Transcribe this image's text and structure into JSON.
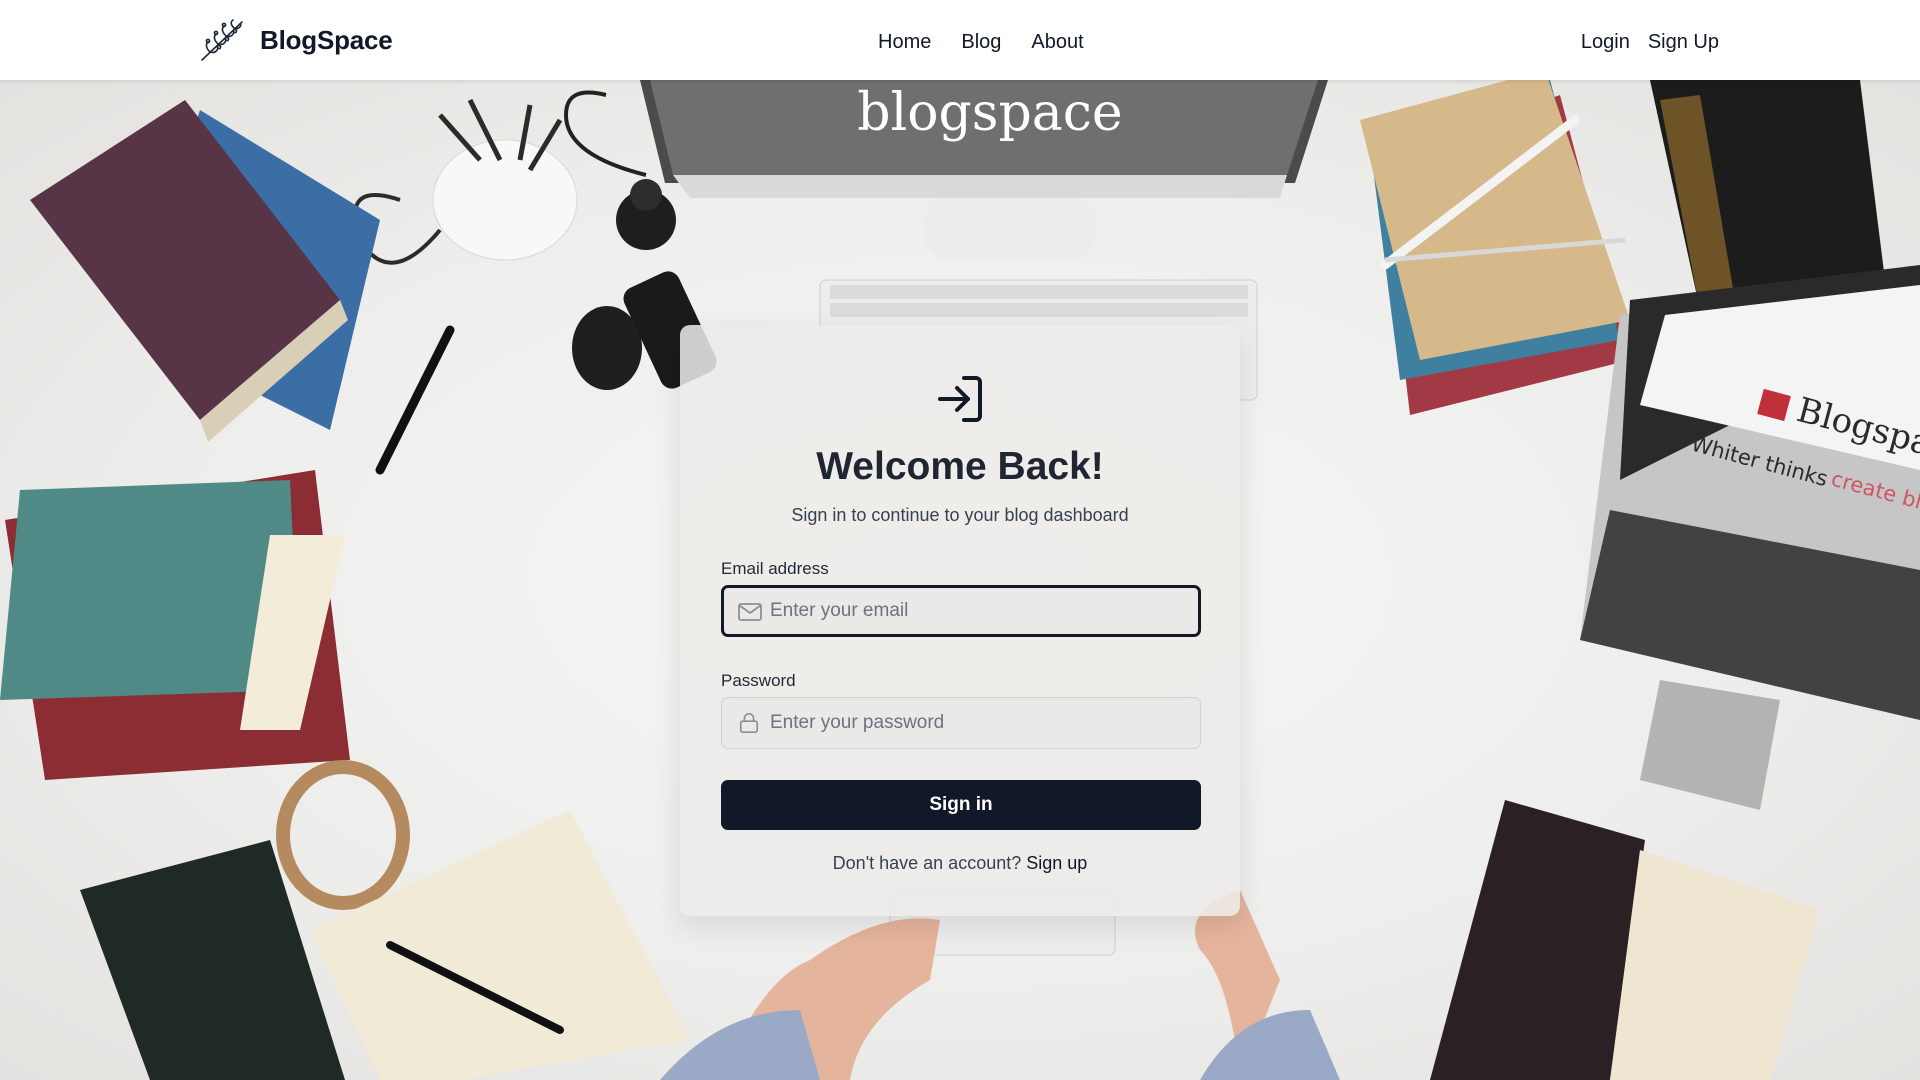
{
  "nav": {
    "brand": "BlogSpace",
    "links": [
      {
        "label": "Home"
      },
      {
        "label": "Blog"
      },
      {
        "label": "About"
      }
    ],
    "login": "Login",
    "signup": "Sign Up"
  },
  "background": {
    "monitor_text": "blogspace",
    "laptop_title": "Blogspac",
    "laptop_subtitle": "Whiter thinks",
    "laptop_tagline": "create bl"
  },
  "login_card": {
    "icon": "log-in-icon",
    "title": "Welcome Back!",
    "subtitle": "Sign in to continue to your blog dashboard",
    "email": {
      "label": "Email address",
      "placeholder": "Enter your email",
      "value": "",
      "icon": "mail-icon",
      "focused": true
    },
    "password": {
      "label": "Password",
      "placeholder": "Enter your password",
      "value": "",
      "icon": "lock-icon"
    },
    "submit_label": "Sign in",
    "signup_prompt": "Don't have an account?",
    "signup_link": "Sign up"
  },
  "colors": {
    "primary": "#111827",
    "card_bg": "#ecebe9",
    "text_muted": "#374151"
  }
}
